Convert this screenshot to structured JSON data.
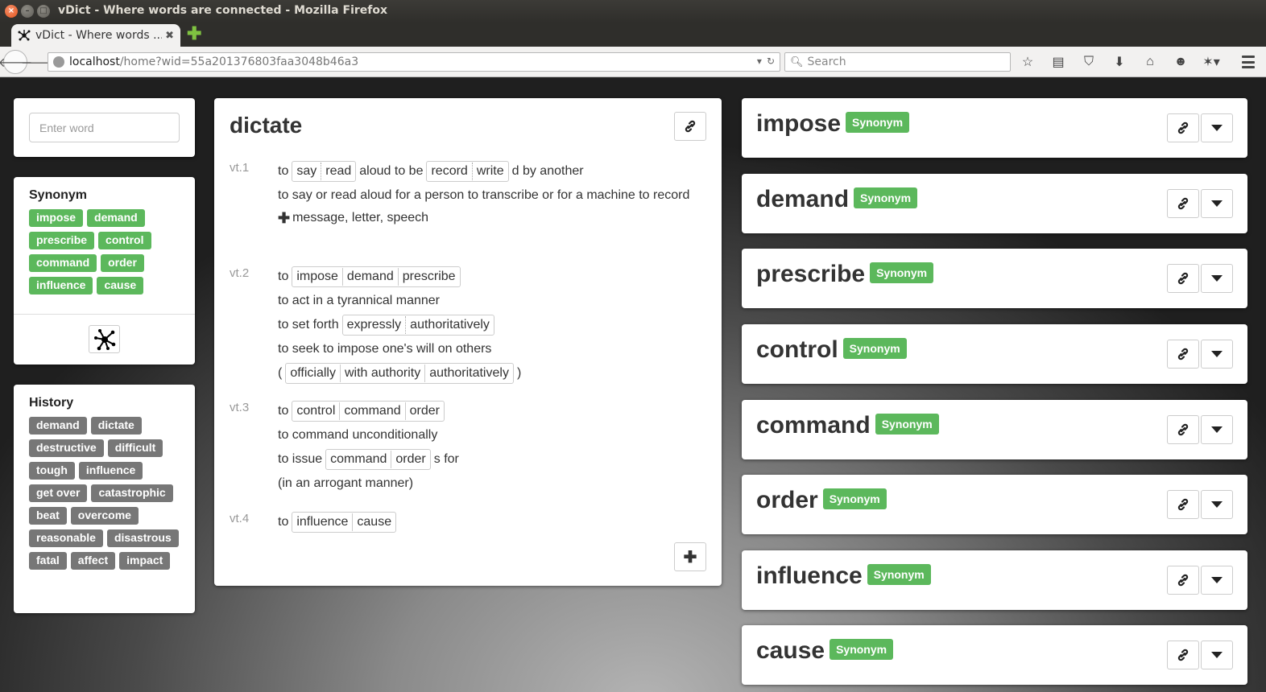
{
  "window": {
    "title": "vDict - Where words are connected - Mozilla Firefox",
    "tab_title": "vDict - Where words ...",
    "new_tab_icon": "plus-icon"
  },
  "navbar": {
    "url_host": "localhost",
    "url_path": "/home?wid=55a201376803faa3048b46a3",
    "search_placeholder": "Search",
    "icons": [
      "bookmark-star-icon",
      "reading-list-icon",
      "pocket-icon",
      "download-icon",
      "home-icon",
      "chat-icon",
      "extension-icon",
      "menu-icon"
    ]
  },
  "search": {
    "placeholder": "Enter word"
  },
  "synonym_panel": {
    "heading": "Synonym",
    "tags": [
      "impose",
      "demand",
      "prescribe",
      "control",
      "command",
      "order",
      "influence",
      "cause"
    ],
    "color": "#5cb85c"
  },
  "history_panel": {
    "heading": "History",
    "tags": [
      "demand",
      "dictate",
      "destructive",
      "difficult",
      "tough",
      "influence",
      "get over",
      "catastrophic",
      "beat",
      "overcome",
      "reasonable",
      "disastrous",
      "fatal",
      "affect",
      "impact"
    ],
    "color": "#777777"
  },
  "entry": {
    "word": "dictate",
    "senses": [
      {
        "label": "vt.1",
        "lines": [
          {
            "parts": [
              {
                "t": "to"
              },
              {
                "g": [
                  "say",
                  "read"
                ],
                "dotted": true
              },
              {
                "t": "aloud to be"
              },
              {
                "g": [
                  "record",
                  "write"
                ],
                "dotted": true
              },
              {
                "t": "d by another"
              }
            ]
          },
          {
            "text": "to say or read aloud for a person to transcribe or for a machine to record"
          },
          {
            "plus": "message, letter, speech"
          }
        ]
      },
      {
        "label": "vt.2",
        "lines": [
          {
            "parts": [
              {
                "t": "to"
              },
              {
                "g": [
                  "impose",
                  "demand",
                  "prescribe"
                ]
              }
            ]
          },
          {
            "text": "to act in a tyrannical manner"
          },
          {
            "parts": [
              {
                "t": "to set forth"
              },
              {
                "g": [
                  "expressly",
                  "authoritatively"
                ],
                "dotted": true
              }
            ]
          },
          {
            "text": "to seek to impose one's will on others"
          },
          {
            "parts": [
              {
                "t": "("
              },
              {
                "g": [
                  "officially",
                  "with authority",
                  "authoritatively"
                ]
              },
              {
                "t": ")"
              }
            ]
          }
        ]
      },
      {
        "label": "vt.3",
        "lines": [
          {
            "parts": [
              {
                "t": "to"
              },
              {
                "g": [
                  "control",
                  "command",
                  "order"
                ]
              }
            ]
          },
          {
            "text": "to command unconditionally"
          },
          {
            "parts": [
              {
                "t": "to issue"
              },
              {
                "g": [
                  "command",
                  "order"
                ]
              },
              {
                "t": "s for"
              }
            ]
          },
          {
            "text": "(in an arrogant manner)"
          }
        ]
      },
      {
        "label": "vt.4",
        "lines": [
          {
            "parts": [
              {
                "t": "to"
              },
              {
                "g": [
                  "influence",
                  "cause"
                ]
              }
            ]
          }
        ]
      }
    ]
  },
  "related": [
    {
      "word": "impose",
      "badge": "Synonym"
    },
    {
      "word": "demand",
      "badge": "Synonym"
    },
    {
      "word": "prescribe",
      "badge": "Synonym"
    },
    {
      "word": "control",
      "badge": "Synonym"
    },
    {
      "word": "command",
      "badge": "Synonym"
    },
    {
      "word": "order",
      "badge": "Synonym"
    },
    {
      "word": "influence",
      "badge": "Synonym"
    },
    {
      "word": "cause",
      "badge": "Synonym"
    }
  ]
}
